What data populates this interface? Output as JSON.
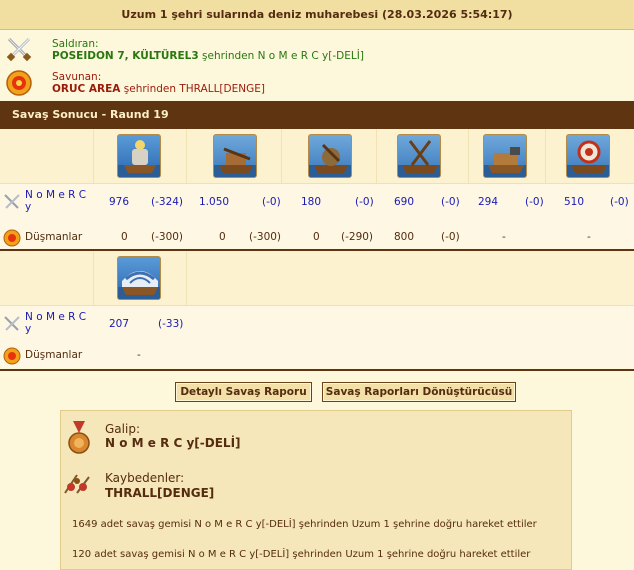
{
  "title": "Uzum 1 şehri sularında deniz muharebesi (28.03.2026 5:54:17)",
  "attacker": {
    "role_label": "Saldıran:",
    "names_bold": "POSEIDON 7, KÜLTÜREL3",
    "names_rest": " şehrinden N o M e R C y[-DELİ]",
    "icon": "crossed-swords-icon"
  },
  "defender": {
    "role_label": "Savunan:",
    "names_bold": "ORUC AREA",
    "names_rest": " şehrinden THRALL[DENGE]",
    "icon": "orange-shield-icon"
  },
  "round_title": "Savaş Sonucu - Raund 19",
  "block1": {
    "player_name": "N o M e R C y",
    "enemy_label": "Düşmanlar",
    "units": [
      {
        "icon": "fire-ship-icon",
        "own": "976",
        "own_loss": "(-324)",
        "enemy": "0",
        "enemy_loss": "(-300)"
      },
      {
        "icon": "ballista-ship-icon",
        "own": "1.050",
        "own_loss": "(-0)",
        "enemy": "0",
        "enemy_loss": "(-300)"
      },
      {
        "icon": "catapult-ship-icon",
        "own": "180",
        "own_loss": "(-0)",
        "enemy": "0",
        "enemy_loss": "(-290)"
      },
      {
        "icon": "ram-ship-icon",
        "own": "690",
        "own_loss": "(-0)",
        "enemy": "800",
        "enemy_loss": "(-0)"
      },
      {
        "icon": "mortar-ship-icon",
        "own": "294",
        "own_loss": "(-0)",
        "enemy": "-",
        "enemy_loss": ""
      },
      {
        "icon": "rocket-ship-icon",
        "own": "510",
        "own_loss": "(-0)",
        "enemy": "-",
        "enemy_loss": ""
      }
    ]
  },
  "block2": {
    "player_name": "N o M e R C y",
    "enemy_label": "Düşmanlar",
    "units": [
      {
        "icon": "paddle-steamer-icon",
        "own": "207",
        "own_loss": "(-33)",
        "enemy": "-",
        "enemy_loss": ""
      }
    ]
  },
  "buttons": {
    "detail_report": "Detaylı Savaş Raporu",
    "converter": "Savaş Raporları Dönüştürücüsü"
  },
  "result": {
    "winner_label": "Galip:",
    "winner_value": "N o M e R C y[-DELİ]",
    "loser_label": "Kaybedenler:",
    "loser_value": "THRALL[DENGE]",
    "movements": [
      "1649 adet savaş gemisi N o M e R C y[-DELİ] şehrinden Uzum 1 şehrine doğru hareket ettiler",
      "120 adet savaş gemisi N o M e R C y[-DELİ] şehrinden Uzum 1 şehrine doğru hareket ettiler"
    ]
  },
  "colors": {
    "dark_bar": "#5f3511",
    "attacker_green": "#28780f",
    "defender_red": "#9b1b0a",
    "value_blue": "#1a1ab5"
  }
}
